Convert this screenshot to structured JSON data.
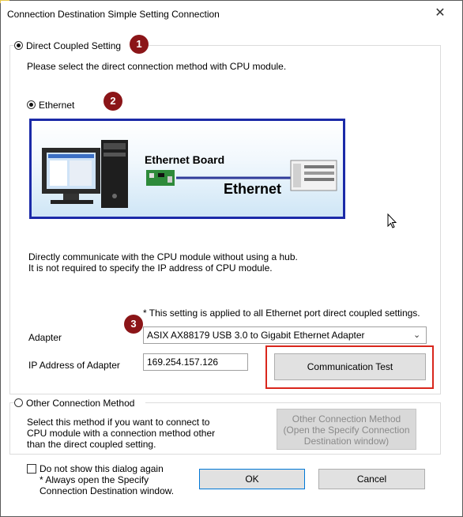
{
  "window": {
    "title": "Connection Destination Simple Setting Connection"
  },
  "direct": {
    "radio_label": "Direct Coupled Setting",
    "instruction": "Please select the direct connection method with CPU module.",
    "ethernet_label": "Ethernet",
    "diagram": {
      "board_label": "Ethernet Board",
      "cable_label": "Ethernet"
    },
    "description_line1": "Directly communicate with the CPU module without using a hub.",
    "description_line2": "It is not required to specify the IP address of CPU module.",
    "note": "* This setting is applied to all Ethernet port direct coupled settings.",
    "adapter_label": "Adapter",
    "adapter_value": "ASIX AX88179 USB 3.0 to Gigabit Ethernet Adapter",
    "ip_label": "IP Address of Adapter",
    "ip_value": "169.254.157.126",
    "test_button": "Communication Test"
  },
  "other": {
    "radio_label": "Other Connection Method",
    "desc_line1": "Select this method if you want to connect to",
    "desc_line2": "CPU module with a connection method other",
    "desc_line3": "than the direct coupled setting.",
    "button_line1": "Other Connection Method",
    "button_line2": "(Open the Specify Connection",
    "button_line3": "Destination window)"
  },
  "footer": {
    "checkbox_label": "Do not show this dialog again",
    "checkbox_note1": "* Always open the Specify",
    "checkbox_note2": "Connection Destination window.",
    "ok": "OK",
    "cancel": "Cancel"
  },
  "annotations": {
    "badge1": "1",
    "badge2": "2",
    "badge3": "3"
  },
  "colors": {
    "badge": "#8b1518",
    "highlight_box": "#d9261c",
    "diagram_border": "#1b2aa8"
  }
}
